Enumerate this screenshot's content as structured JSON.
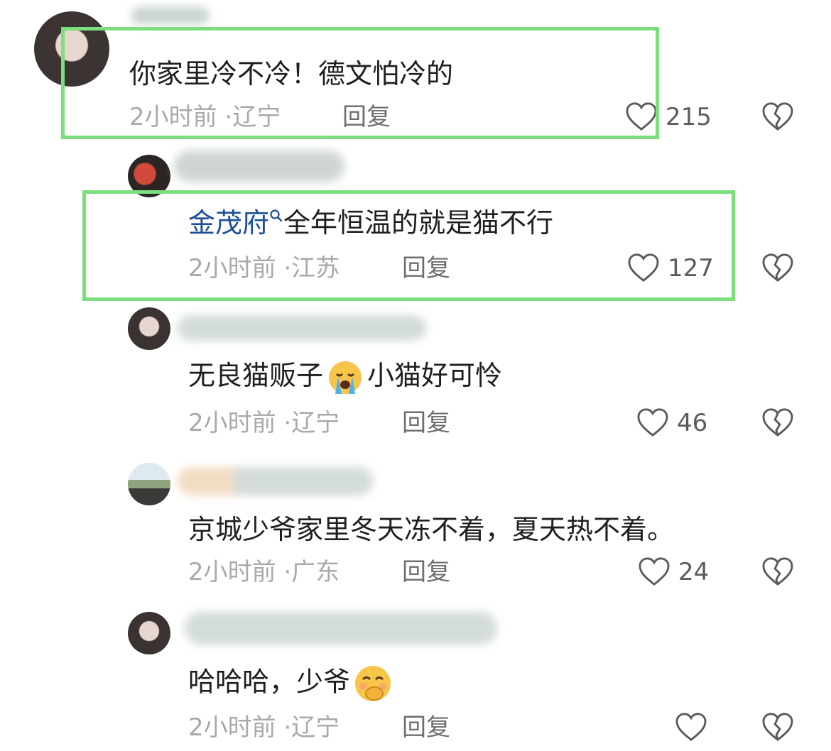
{
  "comments": [
    {
      "text": "你家里冷不冷！德文怕冷的",
      "time": "2小时前",
      "location": "辽宁",
      "reply_label": "回复",
      "likes": "215",
      "highlighted": true
    },
    {
      "mention": "金茂府",
      "text": "全年恒温的就是猫不行",
      "time": "2小时前",
      "location": "江苏",
      "reply_label": "回复",
      "likes": "127",
      "highlighted": true
    },
    {
      "text_before": "无良猫贩子",
      "emoji": "loudly-crying-face",
      "text_after": "小猫好可怜",
      "time": "2小时前",
      "location": "辽宁",
      "reply_label": "回复",
      "likes": "46"
    },
    {
      "text": "京城少爷家里冬天冻不着，夏天热不着。",
      "time": "2小时前",
      "location": "广东",
      "reply_label": "回复",
      "likes": "24"
    },
    {
      "text_before": "哈哈哈，少爷",
      "emoji": "smirking-face",
      "time": "2小时前",
      "location": "辽宁",
      "reply_label": "回复",
      "likes": ""
    }
  ],
  "meta_separator": "·",
  "icons": {
    "like": "heart-outline-icon",
    "dislike": "broken-heart-icon",
    "mention_search": "search-icon"
  },
  "colors": {
    "highlight": "#7ede7e",
    "mention_link": "#1e4f94",
    "meta_text": "#a9a9a9"
  }
}
